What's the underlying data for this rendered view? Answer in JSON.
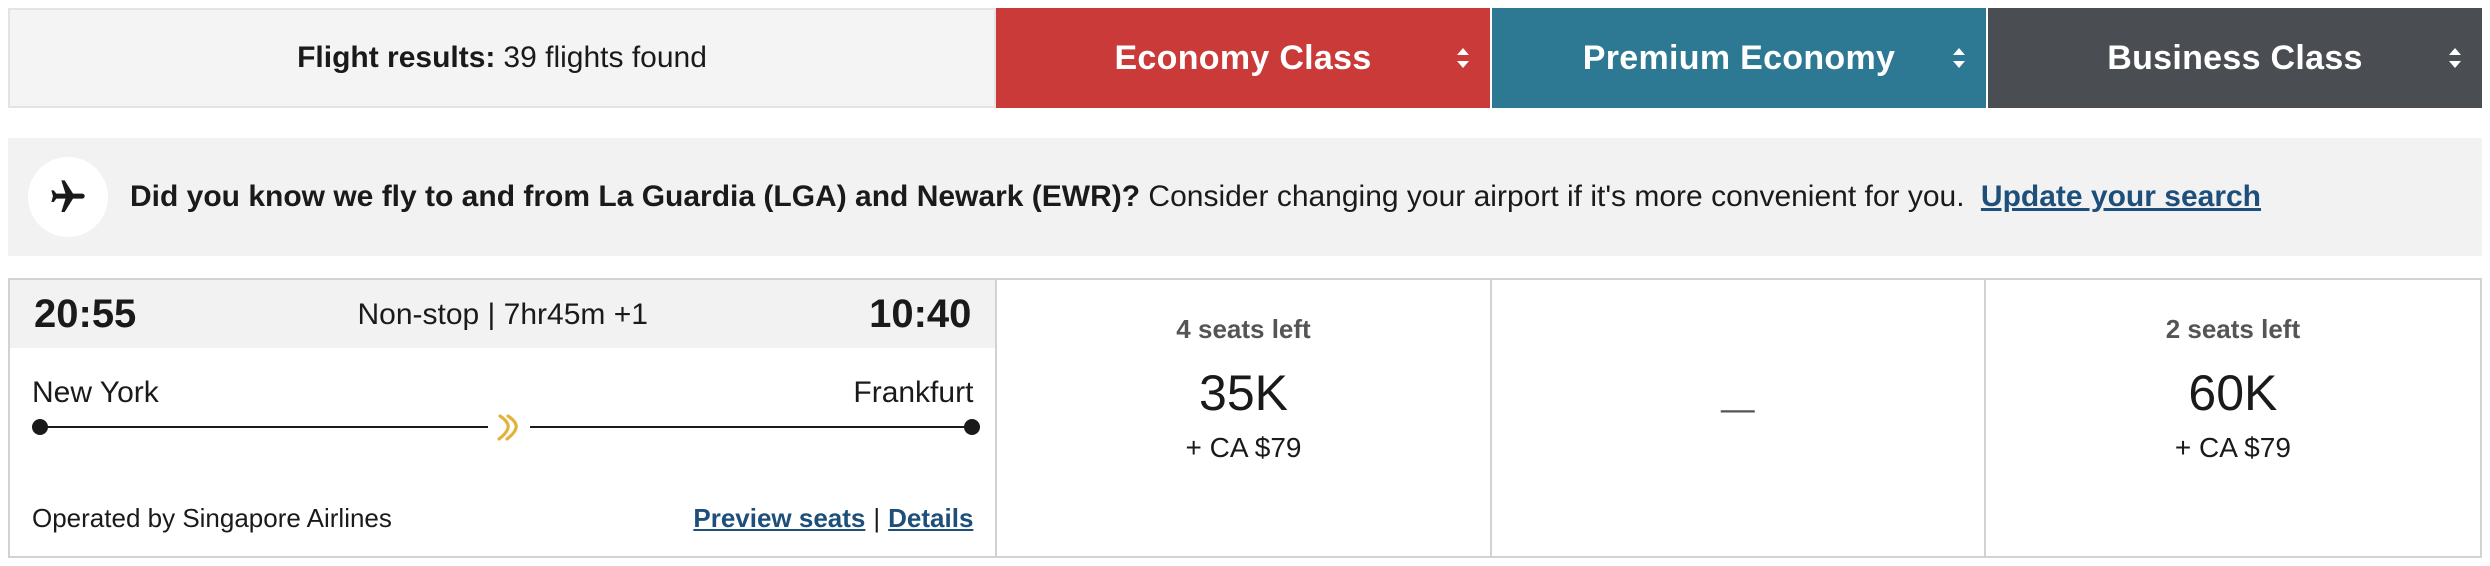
{
  "colors": {
    "economy": "#c93a39",
    "premium_economy": "#2d7893",
    "business": "#4a4d51",
    "link": "#1d4f7a",
    "logo_gold": "#e3b23c"
  },
  "results": {
    "label": "Flight results:",
    "count": "39 flights found"
  },
  "cabins": [
    {
      "label": "Economy Class",
      "icon": "sort-icon"
    },
    {
      "label": "Premium Economy",
      "icon": "sort-icon"
    },
    {
      "label": "Business Class",
      "icon": "sort-icon"
    }
  ],
  "banner": {
    "icon": "airplane-icon",
    "bold_text": "Did you know we fly to and from La Guardia (LGA) and Newark (EWR)?",
    "text": "Consider changing your airport if it's more convenient for you.",
    "link": "Update your search"
  },
  "flight": {
    "departure_time": "20:55",
    "arrival_time": "10:40",
    "stops_duration": "Non-stop | 7hr45m +1",
    "origin": "New York",
    "destination": "Frankfurt",
    "airline_icon": "singapore-airlines-logo-icon",
    "operated_by": "Operated by Singapore Airlines",
    "preview_seats": "Preview seats",
    "separator": "|",
    "details": "Details"
  },
  "fares": [
    {
      "cabin": "Economy Class",
      "seats_left": "4 seats left",
      "miles": "35K",
      "tax": "+ CA $79"
    },
    {
      "cabin": "Premium Economy",
      "unavailable": "—"
    },
    {
      "cabin": "Business Class",
      "seats_left": "2 seats left",
      "miles": "60K",
      "tax": "+ CA $79"
    }
  ]
}
